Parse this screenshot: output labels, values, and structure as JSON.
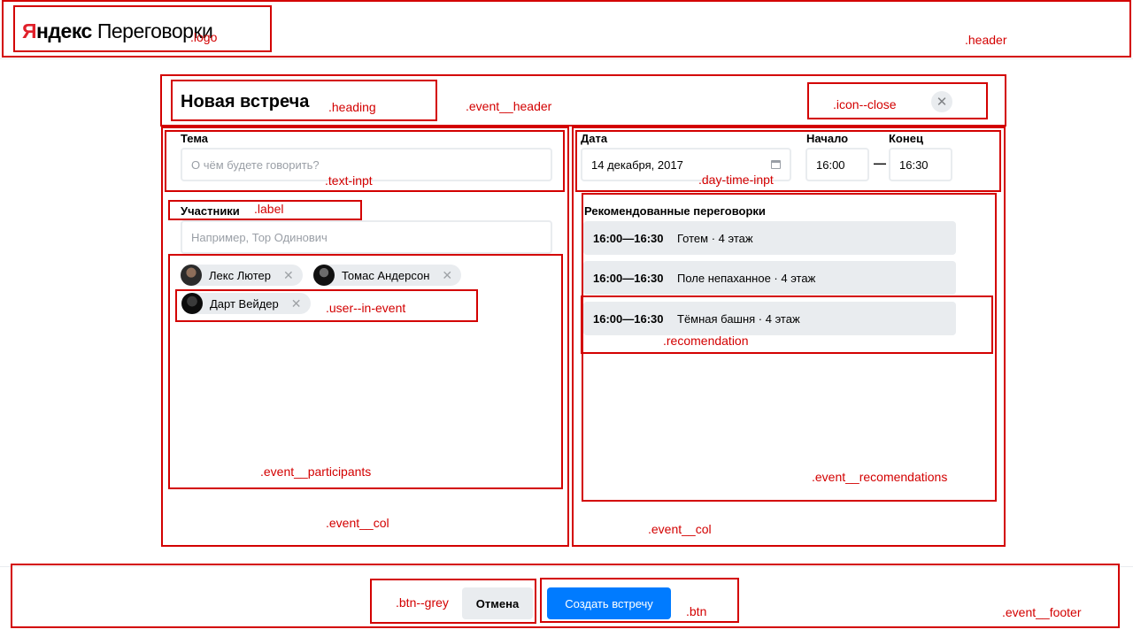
{
  "header": {
    "logo_ya": "Я",
    "logo_rest": "ндекс",
    "logo_product": "Переговорки"
  },
  "event": {
    "heading": "Новая встреча",
    "close_icon": "close-icon",
    "topic": {
      "label": "Тема",
      "placeholder": "О чём будете говорить?"
    },
    "date": {
      "label": "Дата",
      "value": "14 декабря, 2017",
      "icon": "calendar-icon"
    },
    "start": {
      "label": "Начало",
      "value": "16:00"
    },
    "end": {
      "label": "Конец",
      "value": "16:30"
    },
    "dash": "—",
    "participants": {
      "label": "Участники",
      "placeholder": "Например, Тор Одинович",
      "users": [
        {
          "name": "Лекс Лютер"
        },
        {
          "name": "Томас Андерсон"
        },
        {
          "name": "Дарт Вейдер"
        }
      ],
      "remove_glyph": "✕"
    },
    "recommendations": {
      "title": "Рекомендованные переговорки",
      "items": [
        {
          "time": "16:00—16:30",
          "room": "Готем · 4 этаж"
        },
        {
          "time": "16:00—16:30",
          "room": "Поле непаханное · 4 этаж"
        },
        {
          "time": "16:00—16:30",
          "room": "Тёмная башня · 4 этаж"
        }
      ]
    },
    "footer": {
      "cancel_label": "Отмена",
      "create_label": "Создать встречу"
    }
  },
  "annotations": {
    "logo": ".logo",
    "header": ".header",
    "heading": ".heading",
    "event_header": ".event__header",
    "icon_close": ".icon--close",
    "text_inpt": ".text-inpt",
    "day_time_inpt": ".day-time-inpt",
    "label": ".label",
    "user_in_event": ".user--in-event",
    "recomendation": ".recomendation",
    "event_participants": ".event__participants",
    "event_recomendations": ".event__recomendations",
    "event_col_left": ".event__col",
    "event_col_right": ".event__col",
    "btn_grey": ".btn--grey",
    "btn": ".btn",
    "event_footer": ".event__footer"
  },
  "colors": {
    "annotation": "#d30000",
    "brand_red": "#e0202a",
    "primary": "#007bff",
    "grey_bg": "#e9ecef"
  }
}
